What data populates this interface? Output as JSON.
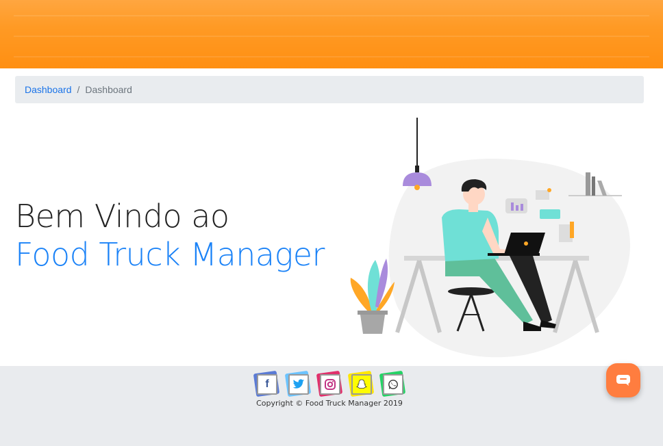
{
  "header": {
    "color": "#ff9a24"
  },
  "breadcrumb": {
    "items": [
      {
        "label": "Dashboard",
        "link": true
      },
      {
        "label": "Dashboard",
        "link": false
      }
    ],
    "separator": "/"
  },
  "hero": {
    "line1": "Bem Vindo ao",
    "line2": "Food Truck Manager",
    "accent": "#1a82f7"
  },
  "footer": {
    "social": [
      {
        "name": "facebook",
        "icon": "facebook-icon",
        "color": "#3b5998",
        "glyph": "f"
      },
      {
        "name": "twitter",
        "icon": "twitter-icon",
        "color": "#1da1f2",
        "glyph": "🐦"
      },
      {
        "name": "instagram",
        "icon": "instagram-icon",
        "color": "#c13584",
        "glyph": "◎"
      },
      {
        "name": "snapchat",
        "icon": "snapchat-icon",
        "color": "#fffc00",
        "glyph": "👻"
      },
      {
        "name": "whatsapp",
        "icon": "whatsapp-icon",
        "color": "#25d366",
        "glyph": "✆"
      }
    ],
    "copyright": "Copyright © Food Truck Manager 2019"
  },
  "chat": {
    "icon": "chat-icon",
    "color": "#ff7d3f"
  }
}
